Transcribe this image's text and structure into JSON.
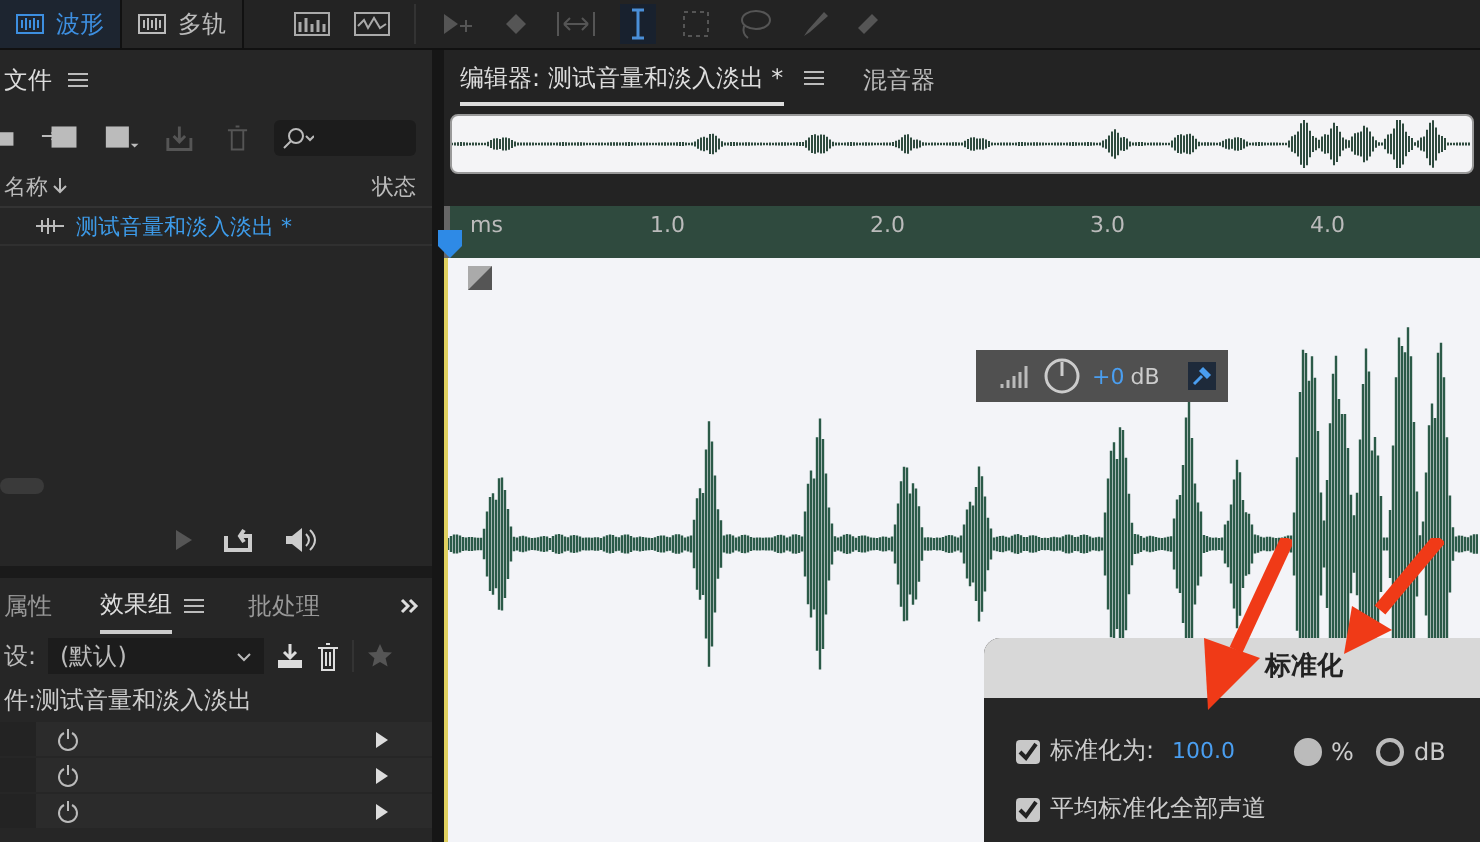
{
  "mode_tabs": [
    {
      "label": "波形",
      "selected": true
    },
    {
      "label": "多轨",
      "selected": false
    }
  ],
  "files_panel": {
    "title": "文件",
    "name_column": "名称",
    "status_column": "状态",
    "files": [
      {
        "name": "测试音量和淡入淡出 *",
        "selected": true
      }
    ]
  },
  "effects_panel": {
    "tabs": [
      {
        "label": "属性",
        "selected": false
      },
      {
        "label": "效果组",
        "selected": true
      },
      {
        "label": "批处理",
        "selected": false
      }
    ],
    "preset_label": "设:",
    "preset_value": "(默认)",
    "file_label": "件:测试音量和淡入淡出"
  },
  "editor": {
    "tabs": [
      {
        "label": "编辑器: 测试音量和淡入淡出 *",
        "selected": true
      },
      {
        "label": "混音器",
        "selected": false
      }
    ],
    "ruler_labels": [
      "ms",
      "1.0",
      "2.0",
      "3.0",
      "4.0"
    ],
    "hud": {
      "value": "+0",
      "unit": "dB"
    }
  },
  "dialog": {
    "title": "标准化",
    "normalize": {
      "label": "标准化为:",
      "checked": true,
      "value": "100.0"
    },
    "units": [
      {
        "label": "%",
        "selected": true
      },
      {
        "label": "dB",
        "selected": false
      }
    ],
    "options": [
      {
        "label": "平均标准化全部声道",
        "checked": true
      }
    ]
  }
}
